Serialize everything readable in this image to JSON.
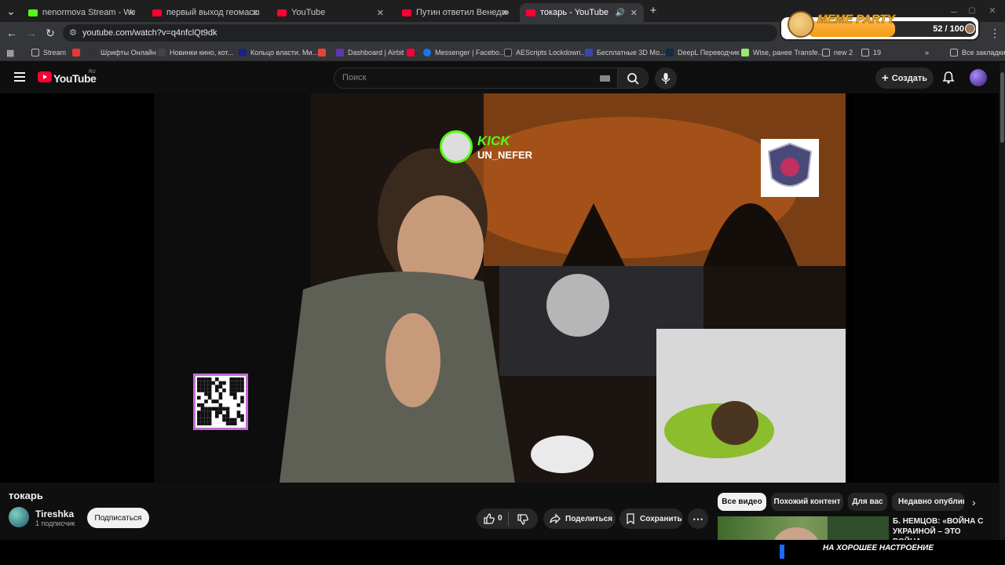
{
  "browser": {
    "tabs": [
      {
        "label": "nenormova Stream - Watch Live",
        "favicon": "kick-icon",
        "active": false
      },
      {
        "label": "первый выход геомассыча - YouTube",
        "favicon": "youtube-icon",
        "active": false
      },
      {
        "label": "YouTube",
        "favicon": "youtube-icon",
        "active": false
      },
      {
        "label": "Путин ответил Венедиктову - YouTube",
        "favicon": "youtube-icon",
        "active": false
      },
      {
        "label": "токарь - YouTube",
        "favicon": "youtube-icon",
        "active": true
      }
    ],
    "url": "youtube.com/watch?v=q4nfclQt9dk",
    "bookmarks": [
      {
        "label": "Stream",
        "icon": "folder-icon"
      },
      {
        "label": "",
        "icon": "red-square-icon"
      },
      {
        "label": "Шрифты Онлайн",
        "icon": "fonts-icon"
      },
      {
        "label": "Новинки кино, кот...",
        "icon": "film-icon"
      },
      {
        "label": "Кольцо власти. Ми...",
        "icon": "r-icon"
      },
      {
        "label": "",
        "icon": "gmail-icon"
      },
      {
        "label": "Dashboard | Airbit",
        "icon": "airbit-icon"
      },
      {
        "label": "",
        "icon": "youtube-icon"
      },
      {
        "label": "Messenger | Facebo...",
        "icon": "facebook-icon"
      },
      {
        "label": "AEScripts Lockdown...",
        "icon": "aescripts-icon"
      },
      {
        "label": "Бесплатные 3D Мо...",
        "icon": "3d-icon"
      },
      {
        "label": "DeepL Переводчик",
        "icon": "deepl-icon"
      },
      {
        "label": "Wise, ранее Transfe...",
        "icon": "wise-icon"
      },
      {
        "label": "new 2",
        "icon": "folder-icon"
      },
      {
        "label": "19",
        "icon": "folder-icon"
      }
    ],
    "all_bookmarks": "Все закладки"
  },
  "meme_party": {
    "title": "MEME PARTY",
    "count": "52 / 100",
    "progress": 0.52
  },
  "youtube": {
    "logo_text": "YouTube",
    "region": "RU",
    "search_placeholder": "Поиск",
    "create_label": "Создать"
  },
  "video": {
    "overlay_brand": "KICK",
    "overlay_user": "UN_NEFER",
    "title": "токарь",
    "channel": "Tireshka",
    "subscribers": "1 подписчик",
    "subscribe_label": "Подписаться",
    "likes": "0",
    "share_label": "Поделиться",
    "save_label": "Сохранить"
  },
  "recommendations": {
    "chips": [
      {
        "label": "Все видео",
        "active": true
      },
      {
        "label": "Похожий контент",
        "active": false
      },
      {
        "label": "Для вас",
        "active": false
      },
      {
        "label": "Недавно опубликованные",
        "active": false
      }
    ],
    "first_title": "Б. НЕМЦОВ: «ВОЙНА С УКРАИНОЙ – ЭТО ВОЙНА"
  },
  "bottom_overlay": "НА ХОРОШЕЕ НАСТРОЕНИЕ",
  "colors": {
    "youtube_red": "#ff0033",
    "kick_green": "#53fc18",
    "page_bg": "#0f0f0f"
  }
}
